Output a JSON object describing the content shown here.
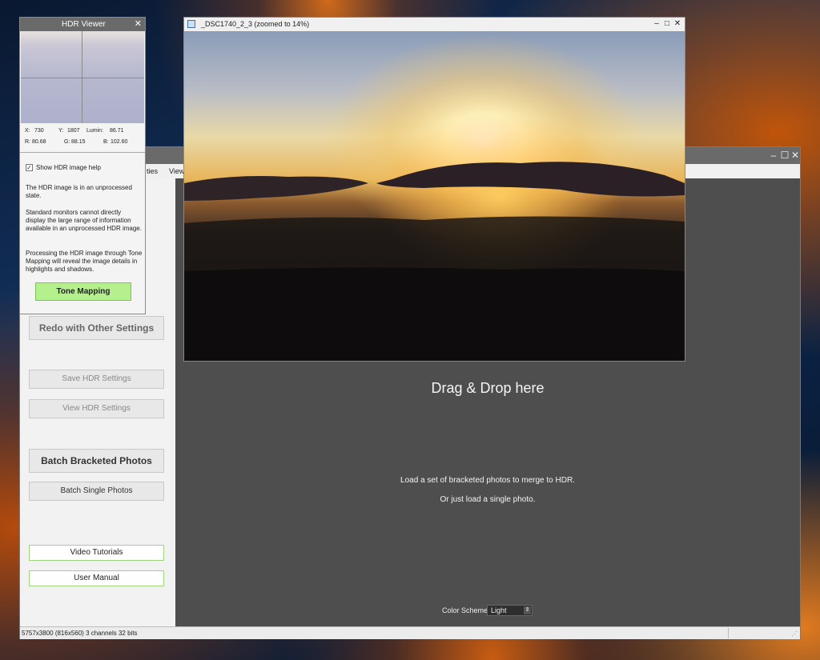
{
  "main_window": {
    "menu": [
      "ties",
      "View"
    ]
  },
  "left_panel": {
    "redo_label": "Redo with Other Settings",
    "save_hdr_label": "Save HDR Settings",
    "view_hdr_label": "View HDR Settings",
    "batch_bracketed_label": "Batch Bracketed Photos",
    "batch_single_label": "Batch Single Photos",
    "video_tutorials_label": "Video Tutorials",
    "user_manual_label": "User Manual"
  },
  "content": {
    "drag_drop": "Drag & Drop here",
    "load_line1": "Load a set of bracketed photos to merge to HDR.",
    "load_line2": "Or just load a single photo.",
    "color_scheme_label": "Color Scheme:",
    "color_scheme_value": "Light"
  },
  "statusbar": {
    "text": "5757x3800 (816x560) 3 channels 32 bits"
  },
  "image_window": {
    "title": "_DSC1740_2_3 (zoomed to 14%)"
  },
  "hdr_viewer": {
    "title": "HDR Viewer",
    "x_label": "X:",
    "x_value": "730",
    "y_label": "Y:",
    "y_value": "1807",
    "lum_label": "Lumin:",
    "lum_value": "86.71",
    "r_label": "R:",
    "r_value": "80.68",
    "g_label": "G:",
    "g_value": "88.15",
    "b_label": "B:",
    "b_value": "102.60",
    "show_help_label": "Show HDR image help",
    "show_help_checked": true,
    "help_p1": "The HDR image is in an unprocessed state.",
    "help_p2": "Standard monitors cannot directly display the large range of information available in an unprocessed HDR image.",
    "help_p3": "Processing the HDR image through Tone Mapping will reveal the image details in highlights and shadows.",
    "tone_mapping_label": "Tone Mapping"
  },
  "colors": {
    "tone_button": "#b4f08c",
    "link_border": "#9ed47e",
    "content_bg": "#4e4e4e"
  }
}
